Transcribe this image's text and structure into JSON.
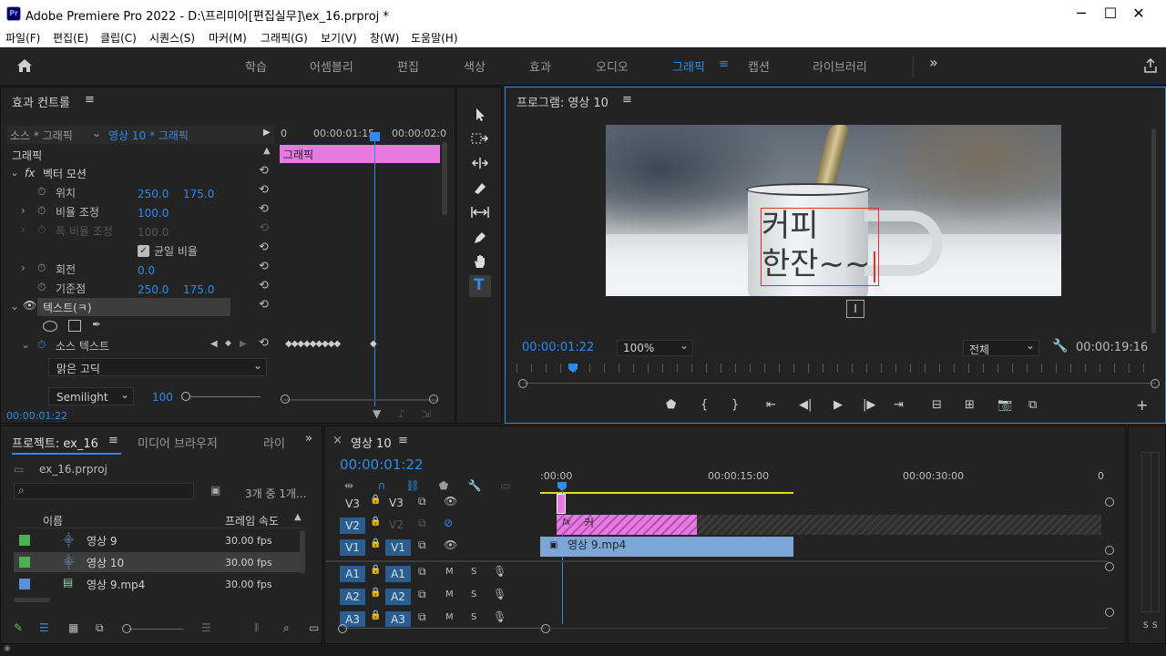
{
  "window": {
    "app_icon": "Pr",
    "title": "Adobe Premiere Pro 2022 - D:\\프리미어[편집실무]\\ex_16.prproj *",
    "minimize": "─",
    "maximize": "☐",
    "close": "✕"
  },
  "menu": [
    "파일(F)",
    "편집(E)",
    "클립(C)",
    "시퀀스(S)",
    "마커(M)",
    "그래픽(G)",
    "보기(V)",
    "창(W)",
    "도움말(H)"
  ],
  "workspaces": {
    "items": [
      "학습",
      "어셈블리",
      "편집",
      "색상",
      "효과",
      "오디오",
      "그래픽",
      "캡션",
      "라이브러리"
    ],
    "active": "그래픽",
    "menu_icon": "≡",
    "more": "»"
  },
  "effect_controls": {
    "title": "효과 컨트롤",
    "menu_icon": "≡",
    "source_label": "소스 * 그래픽",
    "clip_label": "영상 10 * 그래픽",
    "ruler": [
      "0",
      "00:00:01:15",
      "00:00:02:0"
    ],
    "clip_bar_label": "그래픽",
    "section": "그래픽",
    "vector_motion": "벡터 모션",
    "fx": "fx",
    "position": {
      "label": "위치",
      "x": "250.0",
      "y": "175.0"
    },
    "scale": {
      "label": "비율 조정",
      "value": "100.0"
    },
    "scale_width": {
      "label": "폭 비율 조정",
      "value": "100.0"
    },
    "uniform_scale": "균일 비율",
    "rotation": {
      "label": "회전",
      "value": "0.0"
    },
    "anchor": {
      "label": "기준점",
      "x": "250.0",
      "y": "175.0"
    },
    "text_layer": "텍스트(ㅋ)",
    "source_text": "소스 텍스트",
    "font": "맑은 고딕",
    "font_style": "Semilight",
    "font_size": "100",
    "timecode": "00:00:01:22"
  },
  "tools": [
    "selection-tool",
    "track-select-tool",
    "ripple-edit-tool",
    "razor-tool",
    "slip-tool",
    "pen-tool",
    "hand-tool",
    "type-tool"
  ],
  "program_monitor": {
    "title": "프로그램: 영상 10",
    "menu_icon": "≡",
    "overlay_line1": "커피",
    "overlay_line2": "한잔~~",
    "timecode": "00:00:01:22",
    "zoom": "100%",
    "quality": "전체",
    "duration": "00:00:19:16"
  },
  "project": {
    "tab": "프로젝트: ex_16",
    "tab2": "미디어 브라우저",
    "tab3": "라이",
    "more": "»",
    "menu_icon": "≡",
    "file": "ex_16.prproj",
    "count": "3개 중 1개...",
    "col_name": "이름",
    "col_fps": "프레임 속도",
    "items": [
      {
        "name": "영상 9",
        "fps": "30.00 fps",
        "color": "#4caf50",
        "type": "sequence"
      },
      {
        "name": "영상 10",
        "fps": "30.00 fps",
        "color": "#4caf50",
        "type": "sequence"
      },
      {
        "name": "영상 9.mp4",
        "fps": "30.00 fps",
        "color": "#5b8fd6",
        "type": "clip"
      }
    ]
  },
  "timeline": {
    "close": "×",
    "tab": "영상 10",
    "menu_icon": "≡",
    "timecode": "00:00:01:22",
    "ruler": [
      ":00:00",
      "00:00:15:00",
      "00:00:30:00",
      "0"
    ],
    "v_tracks": [
      {
        "src": "V3",
        "name": "V3"
      },
      {
        "src": "V2",
        "name": "V2"
      },
      {
        "src": "V1",
        "name": "V1"
      }
    ],
    "a_tracks": [
      {
        "src": "A1",
        "name": "A1"
      },
      {
        "src": "A2",
        "name": "A2"
      },
      {
        "src": "A3",
        "name": "A3"
      }
    ],
    "graphic_clip": "커",
    "graphic_fx": "fx",
    "video_clip": "영상 9.mp4",
    "mute": "M",
    "solo": "S"
  },
  "audio_meter": {
    "labels": [
      "S",
      "S"
    ]
  }
}
